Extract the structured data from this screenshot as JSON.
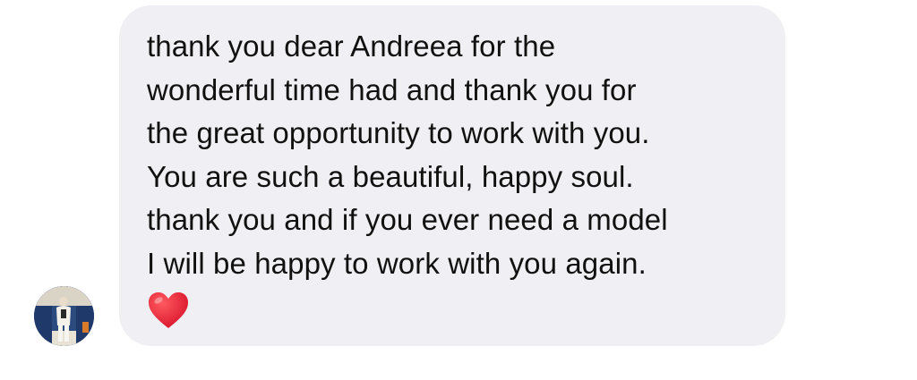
{
  "message": {
    "lines": [
      "thank you dear Andreea for the",
      "wonderful time had and thank you for",
      "the great opportunity to work with you.",
      "You are such a beautiful, happy soul.",
      "thank you and if you ever need a model",
      "I will be happy to work with you again."
    ],
    "reaction_icon": "red-heart-emoji"
  },
  "sender": {
    "avatar_icon": "profile-photo"
  },
  "colors": {
    "bubble_background": "#efeff4",
    "text": "#111111",
    "heart": "#e0182c"
  }
}
